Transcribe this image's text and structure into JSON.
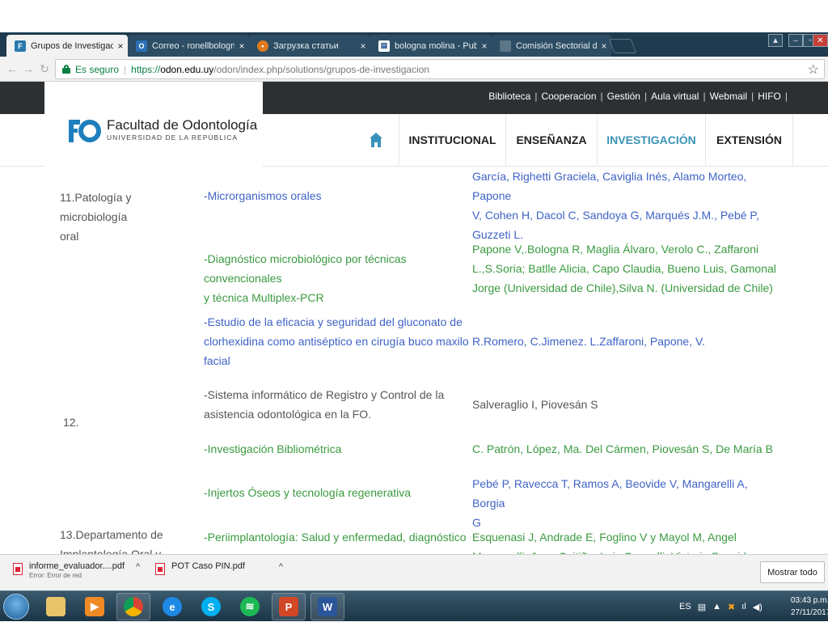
{
  "browser": {
    "tabs": [
      {
        "label": "Grupos de Investigación",
        "icon": "fo-favicon",
        "active": true
      },
      {
        "label": "Correo - ronellbologna@",
        "icon": "outlook-favicon"
      },
      {
        "label": "Загрузка статьи",
        "icon": "download-favicon"
      },
      {
        "label": "bologna molina - PubMe",
        "icon": "pubmed-favicon"
      },
      {
        "label": "Comisión Sectorial de In",
        "icon": "page-favicon"
      }
    ],
    "tab_close_glyph": "×",
    "address": {
      "secure_label": "Es seguro",
      "scheme": "https://",
      "host": "odon.edu.uy",
      "path": "/odon/index.php/solutions/grupos-de-investigacion"
    }
  },
  "site": {
    "top_links": [
      "Biblioteca",
      "Cooperacion",
      "Gestión",
      "Aula virtual",
      "Webmail",
      "HIFO"
    ],
    "logo": {
      "name": "Facultad de Odontología",
      "subtitle": "UNIVERSIDAD DE LA REPÚBLICA"
    },
    "nav": [
      {
        "label": "INSTITUCIONAL"
      },
      {
        "label": "ENSEÑANZA"
      },
      {
        "label": "INVESTIGACIÓN",
        "active": true
      },
      {
        "label": "EXTENSIÓN"
      }
    ]
  },
  "content": {
    "groups": [
      {
        "label_lines": [
          "11.Patología y microbiología",
          "oral"
        ]
      },
      {
        "label_lines": [
          "12."
        ]
      },
      {
        "label_lines": [
          "13.Departamento  de",
          "Implantología Oral y"
        ]
      }
    ],
    "rows": [
      {
        "project_lines": [
          "-Microrganismos orales"
        ],
        "authors_lines": [
          "García, Righetti Graciela, Caviglia Inés, Alamo Morteo, Papone",
          "V, Cohen H, Dacol C, Sandoya G, Marqués J.M., Pebé P,",
          "Guzzeti L."
        ]
      },
      {
        "project_lines": [
          "-Diagnóstico microbiológico por técnicas convencionales",
          "y técnica Multiplex-PCR"
        ],
        "authors_lines": [
          "Papone V,.Bologna R, Maglia Álvaro, Verolo C., Zaffaroni",
          "L.,S.Soria; Batlle Alicia, Capo Claudia, Bueno Luis, Gamonal",
          "Jorge (Universidad de Chile),Silva N. (Universidad de Chile)"
        ]
      },
      {
        "project_lines": [
          "-Estudio de la eficacia y seguridad del gluconato de",
          "clorhexidina como antiséptico en cirugía buco maxilo",
          "facial"
        ],
        "authors_lines": [
          "R.Romero, C.Jimenez. L.Zaffaroni, Papone, V."
        ]
      },
      {
        "project_lines": [
          "-Sistema informático de Registro y Control de la",
          "asistencia odontológica en la FO."
        ],
        "authors_lines": [
          "Salveraglio I, Piovesán S"
        ]
      },
      {
        "project_lines": [
          "-Investigación Bibliométrica"
        ],
        "authors_lines": [
          "C. Patrón, López, Ma. Del Cármen, Piovesán S, De María B"
        ]
      },
      {
        "project_lines": [
          "-Injertos Óseos y tecnología regenerativa"
        ],
        "authors_lines": [
          "Pebé P, Ravecca T, Ramos A, Beovide V, Mangarelli A, Borgia",
          "G"
        ]
      },
      {
        "project_lines": [
          "-Periimplantología: Salud y enfermedad, diagnóstico y",
          "tratamiento"
        ],
        "authors_lines": [
          "Esquenasi J, Andrade E, Foglino V y Mayol M,  Angel",
          "Mangarelli, Juan Cuitiño,  Luis Gonzalli, Victoria Beovide"
        ]
      }
    ]
  },
  "downloads": {
    "items": [
      {
        "name": "informe_evaluador....pdf",
        "status": "Error: Error de red"
      },
      {
        "name": "POT Caso PIN.pdf",
        "status": ""
      }
    ],
    "show_all": "Mostrar todo"
  },
  "taskbar": {
    "apps": [
      {
        "name": "explorer-icon"
      },
      {
        "name": "media-player-icon"
      },
      {
        "name": "chrome-icon"
      },
      {
        "name": "ie-icon"
      },
      {
        "name": "skype-icon"
      },
      {
        "name": "spotify-icon"
      },
      {
        "name": "powerpoint-icon"
      },
      {
        "name": "word-icon"
      }
    ],
    "tray": {
      "lang": "ES",
      "time": "03:43 p.m.",
      "date": "27/11/2017"
    }
  },
  "colors": {
    "nav_active": "#3a93b6",
    "link_blue": "#3f63c5",
    "link_green": "#3a9a40",
    "secure_green": "#0b8043",
    "site_topbar": "#2d3033"
  }
}
